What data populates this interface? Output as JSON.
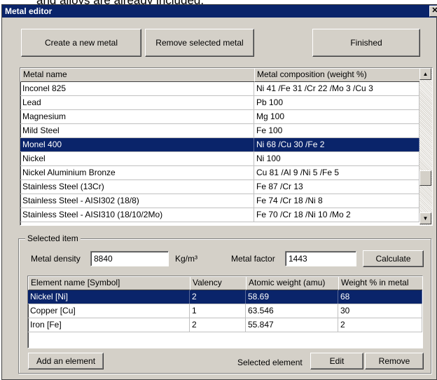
{
  "caption_fragment": "and alloys are already included.",
  "window": {
    "title": "Metal editor",
    "close_label": "✕"
  },
  "toolbar": {
    "create_label": "Create a new metal",
    "remove_label": "Remove selected metal",
    "finished_label": "Finished"
  },
  "metals_table": {
    "headers": [
      "Metal name",
      "Metal composition (weight %)"
    ],
    "rows": [
      {
        "name": "Inconel 825",
        "composition": "Ni 41 /Fe 31 /Cr 22 /Mo 3 /Cu 3"
      },
      {
        "name": "Lead",
        "composition": "Pb 100"
      },
      {
        "name": "Magnesium",
        "composition": "Mg 100"
      },
      {
        "name": "Mild Steel",
        "composition": "Fe 100"
      },
      {
        "name": "Monel 400",
        "composition": "Ni 68 /Cu 30 /Fe 2"
      },
      {
        "name": "Nickel",
        "composition": "Ni 100"
      },
      {
        "name": "Nickel Aluminium Bronze",
        "composition": "Cu 81 /Al 9 /Ni 5 /Fe 5"
      },
      {
        "name": "Stainless Steel (13Cr)",
        "composition": "Fe 87 /Cr 13"
      },
      {
        "name": "Stainless Steel - AISI302 (18/8)",
        "composition": "Fe 74 /Cr 18 /Ni 8"
      },
      {
        "name": "Stainless Steel - AISI310 (18/10/2Mo)",
        "composition": "Fe 70 /Cr 18 /Ni 10 /Mo 2"
      }
    ],
    "selected_index": 4
  },
  "selected_item": {
    "group_label": "Selected item",
    "density_label": "Metal density",
    "density_value": "8840",
    "density_unit": "Kg/m³",
    "factor_label": "Metal factor",
    "factor_value": "1443",
    "calculate_label": "Calculate"
  },
  "elements_table": {
    "headers": [
      "Element name [Symbol]",
      "Valency",
      "Atomic weight (amu)",
      "Weight % in metal"
    ],
    "rows": [
      {
        "name": "Nickel [Ni]",
        "valency": "2",
        "atomic_weight": "58.69",
        "weight_pct": "68"
      },
      {
        "name": "Copper [Cu]",
        "valency": "1",
        "atomic_weight": "63.546",
        "weight_pct": "30"
      },
      {
        "name": "Iron [Fe]",
        "valency": "2",
        "atomic_weight": "55.847",
        "weight_pct": "2"
      }
    ],
    "selected_index": 0
  },
  "bottom_bar": {
    "add_label": "Add an element",
    "selected_element_label": "Selected element",
    "edit_label": "Edit",
    "remove_label": "Remove"
  },
  "colors": {
    "selection": "#0a246a",
    "face": "#d4d0c8",
    "title_bar": "#0a246a"
  }
}
